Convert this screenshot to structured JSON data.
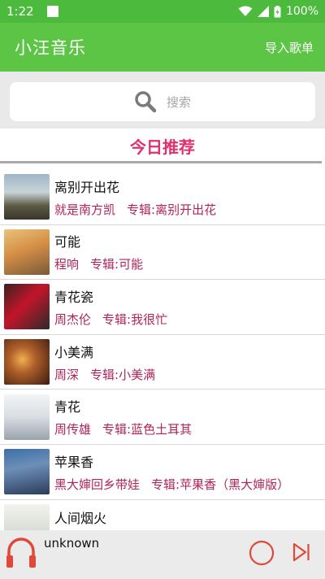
{
  "status_bar": {
    "time": "1:22",
    "battery": "100%"
  },
  "app_bar": {
    "title": "小汪音乐",
    "import_label": "导入歌单"
  },
  "search": {
    "placeholder": "搜索"
  },
  "recommend": {
    "header": "今日推荐"
  },
  "songs": [
    {
      "title": "离别开出花",
      "artist": "就是南方凯",
      "album": "专辑:离别开出花"
    },
    {
      "title": "可能",
      "artist": "程响",
      "album": "专辑:可能"
    },
    {
      "title": "青花瓷",
      "artist": "周杰伦",
      "album": "专辑:我很忙"
    },
    {
      "title": "小美满",
      "artist": "周深",
      "album": "专辑:小美满"
    },
    {
      "title": "青花",
      "artist": "周传雄",
      "album": "专辑:蓝色土耳其"
    },
    {
      "title": "苹果香",
      "artist": "黑大婶回乡带娃",
      "album": "专辑:苹果香（黑大婶版）"
    },
    {
      "title": "人间烟火",
      "artist": "",
      "album": ""
    }
  ],
  "player": {
    "now_playing": "unknown"
  },
  "colors": {
    "app_bar": "#5cc546",
    "accent": "#e0306f",
    "meta": "#b0245a",
    "player_icon": "#e0483a"
  },
  "icons": [
    "search-icon",
    "wifi-icon",
    "signal-icon",
    "battery-icon",
    "headphones-icon",
    "play-circle-icon",
    "skip-next-icon"
  ]
}
